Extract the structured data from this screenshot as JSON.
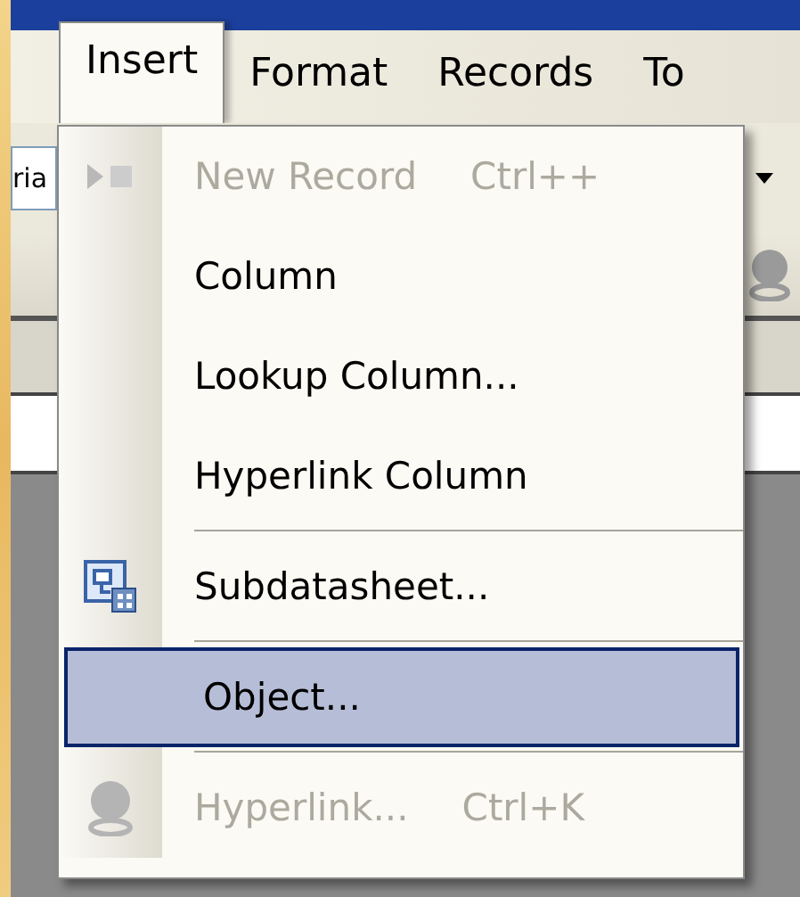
{
  "menu_bar": [
    {
      "label": "Insert",
      "selected": true
    },
    {
      "label": "Format",
      "selected": false
    },
    {
      "label": "Records",
      "selected": false
    },
    {
      "label": "To",
      "selected": false
    }
  ],
  "toolbar": {
    "font_field": "ria"
  },
  "menu": {
    "items": [
      {
        "kind": "record",
        "label": "New Record",
        "shortcut": "Ctrl++",
        "disabled": true,
        "selected": false
      },
      {
        "kind": "command",
        "label": "Column",
        "disabled": false,
        "selected": false
      },
      {
        "kind": "command",
        "label": "Lookup Column...",
        "disabled": false,
        "selected": false
      },
      {
        "kind": "command",
        "label": "Hyperlink Column",
        "disabled": false,
        "selected": false
      },
      {
        "kind": "separator"
      },
      {
        "kind": "subtable",
        "label": "Subdatasheet...",
        "disabled": false,
        "selected": false
      },
      {
        "kind": "separator"
      },
      {
        "kind": "command",
        "label": "Object...",
        "disabled": false,
        "selected": true
      },
      {
        "kind": "separator"
      },
      {
        "kind": "link",
        "label": "Hyperlink...",
        "shortcut": "Ctrl+K",
        "disabled": true,
        "selected": false
      }
    ]
  }
}
